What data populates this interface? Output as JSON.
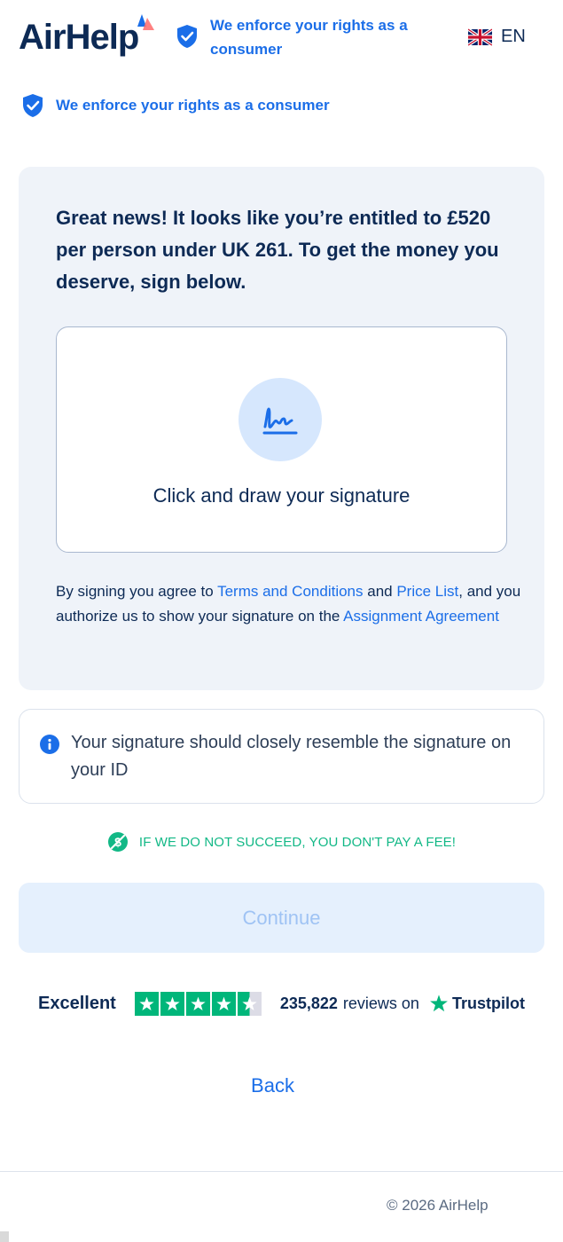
{
  "header": {
    "logo": "AirHelp",
    "claim": "We enforce your rights as a consumer",
    "language": "EN"
  },
  "claim_row": {
    "text": "We enforce your rights as a consumer"
  },
  "signature_card": {
    "headline": "Great news! It looks like you’re entitled to £520 per person under UK 261. To get the money you deserve, sign below.",
    "signature_prompt": "Click and draw your signature",
    "consent": {
      "prefix": "By signing you agree to ",
      "terms_link": "Terms and Conditions",
      "and": " and ",
      "price_link": "Price List",
      "middle": ", and you authorize us to show your signature on the ",
      "agreement_link": "Assignment Agreement"
    }
  },
  "info": {
    "text": "Your signature should closely resemble the signature on your ID"
  },
  "guarantee": {
    "text": "IF WE DO NOT SUCCEED, YOU DON'T PAY A FEE!"
  },
  "continue_button": {
    "label": "Continue",
    "enabled": false
  },
  "trustpilot": {
    "rating_word": "Excellent",
    "rating_stars": 4.5,
    "review_count": "235,822",
    "reviews_on": "reviews on",
    "brand": "Trustpilot"
  },
  "back_link": "Back",
  "footer": {
    "copyright": "© 2026 AirHelp"
  },
  "colors": {
    "brand_blue": "#1b6ee8",
    "navy": "#0d2a55",
    "card_bg": "#eff3f9",
    "success_green": "#12b886",
    "trustpilot_green": "#00b67a"
  },
  "icons": [
    "airhelp-logo-mark",
    "shield-check-icon",
    "uk-flag-icon",
    "signature-icon",
    "info-icon",
    "no-fee-icon",
    "trustpilot-star-icon"
  ]
}
